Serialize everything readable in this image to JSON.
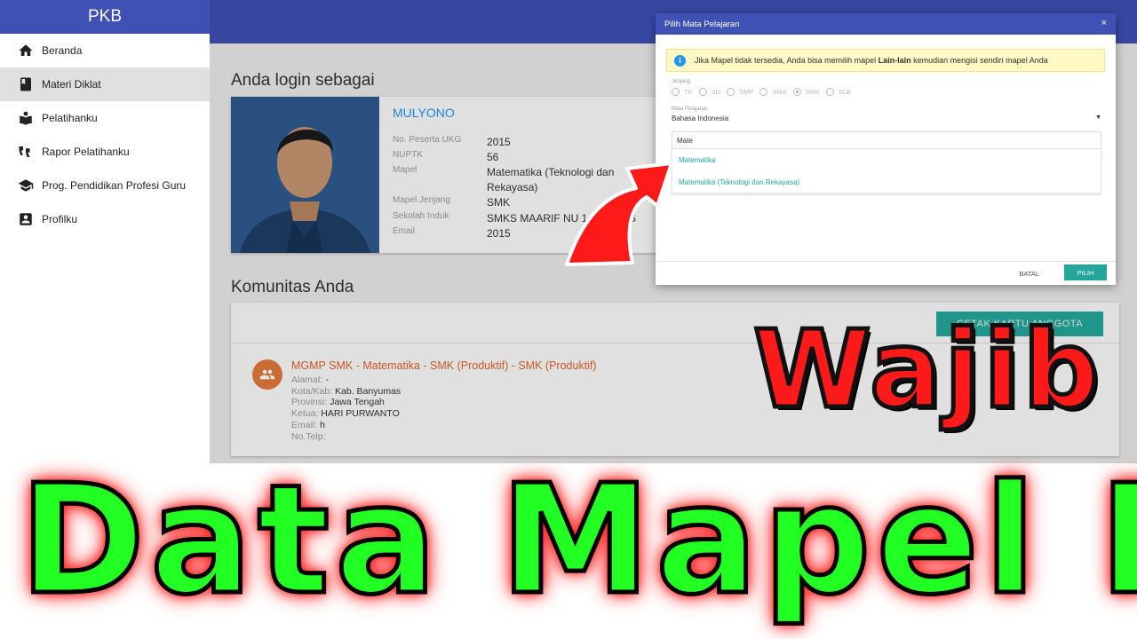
{
  "app": {
    "brand": "PKB"
  },
  "sidebar": {
    "items": [
      {
        "label": "Beranda",
        "icon": "home-icon",
        "active": false
      },
      {
        "label": "Materi Diklat",
        "icon": "book-icon",
        "active": true
      },
      {
        "label": "Pelatihanku",
        "icon": "reader-icon",
        "active": false
      },
      {
        "label": "Rapor Pelatihanku",
        "icon": "quote-icon",
        "active": false
      },
      {
        "label": "Prog. Pendidikan Profesi Guru",
        "icon": "graduation-cap-icon",
        "active": false
      },
      {
        "label": "Profilku",
        "icon": "contact-card-icon",
        "active": false
      }
    ]
  },
  "profile": {
    "section_title": "Anda login sebagai",
    "name": "MULYONO",
    "fields": [
      {
        "key": "No. Peserta UKG",
        "value": "2015"
      },
      {
        "key": "NUPTK",
        "value": "56"
      },
      {
        "key": "Mapel",
        "value": "Matematika (Teknologi dan Rekayasa)"
      },
      {
        "key": "Mapel Jenjang",
        "value": "SMK"
      },
      {
        "key": "Sekolah Induk",
        "value": "SMKS MAARIF NU 1 A        NG"
      },
      {
        "key": "Email",
        "value": "2015"
      }
    ]
  },
  "community": {
    "section_title": "Komunitas Anda",
    "print_button": "CETAK KARTU ANGGOTA",
    "group_title": "MGMP SMK - Matematika - SMK (Produktif) - SMK (Produktif)",
    "lines": [
      {
        "key": "Alamat",
        "value": " -"
      },
      {
        "key": "Kota/Kab",
        "value": " Kab. Banyumas"
      },
      {
        "key": "Provinsi",
        "value": " Jawa Tengah"
      },
      {
        "key": "Ketua",
        "value": " HARI PURWANTO"
      },
      {
        "key": "Email",
        "value": " h"
      },
      {
        "key": "No.Telp",
        "value": ""
      }
    ]
  },
  "modal": {
    "title": "Pilih Mata Pelajaran",
    "close": "×",
    "info_prefix": "Jika Mapel tidak tersedia, Anda bisa memilih mapel ",
    "info_bold": "Lain-lain",
    "info_suffix": " kemudian mengisi sendiri mapel Anda",
    "jenjang_label": "Jenjang",
    "jenjang_options": [
      "TK",
      "SD",
      "SMP",
      "SMA",
      "SMK",
      "SLB"
    ],
    "jenjang_selected": "SMK",
    "mapel_label": "Mata Pelajaran",
    "mapel_selected": "Bahasa Indonesia",
    "search_value": "Mate",
    "results": [
      "Matematika",
      "Matematika (Teknologi dan Rekayasa)"
    ],
    "cancel": "BATAL",
    "choose": "PILIH"
  },
  "overlay": {
    "badge": "Wajib",
    "headline": "Data Mapel PKP"
  },
  "colors": {
    "primary": "#3f51b5",
    "accent": "#26a69a",
    "headline": "#22ff22",
    "badge": "#ff1a1a",
    "arrow": "#ff1a1a"
  }
}
